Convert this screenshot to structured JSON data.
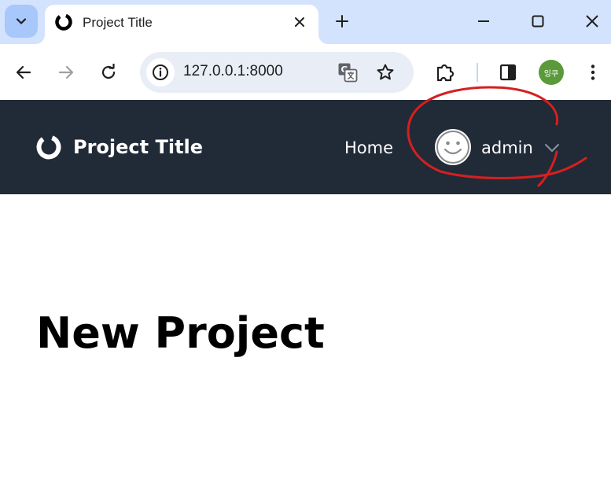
{
  "browser": {
    "tab": {
      "title": "Project Title",
      "favicon": "circle-logo-icon"
    },
    "address_bar": {
      "url": "127.0.0.1:8000"
    },
    "profile_label": "잉쿠",
    "colors": {
      "tabstrip": "#d3e3fd",
      "omnibox": "#e9eef6",
      "profile": "#5b9a3b"
    }
  },
  "navbar": {
    "brand": "Project Title",
    "links": {
      "home": "Home"
    },
    "user": {
      "name": "admin",
      "avatar": "smiley-avatar-icon"
    },
    "colors": {
      "background": "#212a37",
      "text": "#ffffff"
    }
  },
  "main": {
    "heading": "New Project"
  },
  "annotation": {
    "color": "#d42020",
    "shape": "hand-drawn circle around user menu"
  }
}
